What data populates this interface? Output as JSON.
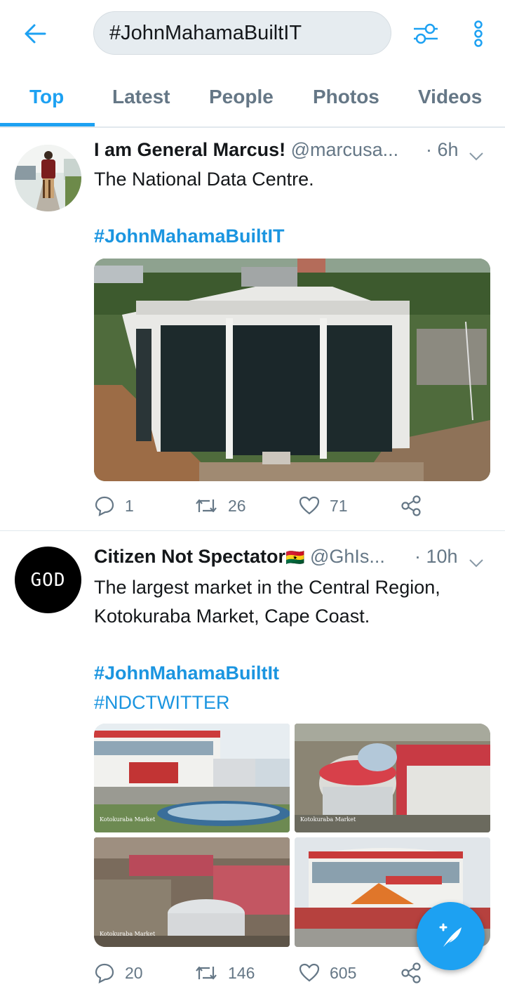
{
  "search": {
    "query": "#JohnMahamaBuiltIT"
  },
  "tabs": [
    {
      "label": "Top"
    },
    {
      "label": "Latest"
    },
    {
      "label": "People"
    },
    {
      "label": "Photos"
    },
    {
      "label": "Videos"
    }
  ],
  "tweets": [
    {
      "name": "I am General Marcus!",
      "handle": "@marcusa...",
      "time": "· 6h",
      "text": "The National Data Centre.",
      "hashtags": [
        "#JohnMahamaBuiltIT"
      ],
      "replies": "1",
      "retweets": "26",
      "likes": "71"
    },
    {
      "name": "Citizen Not Spectator",
      "flag": "🇬🇭",
      "handle": "@GhIs...",
      "time": "· 10h",
      "text_line1": "The largest market in the Central Region,",
      "text_line2": "Kotokuraba Market, Cape Coast.",
      "hashtags": [
        "#JohnMahamaBuiltIt",
        "#NDCTWITTER"
      ],
      "avatar_text": "GOD",
      "image_caption": "Kotokuraba Market",
      "replies": "20",
      "retweets": "146",
      "likes": "605"
    }
  ],
  "colors": {
    "accent": "#1da1f2",
    "muted": "#657786"
  },
  "icons": [
    "back-arrow-icon",
    "filter-icon",
    "more-icon",
    "chevron-down-icon",
    "reply-icon",
    "retweet-icon",
    "like-icon",
    "share-icon",
    "compose-icon"
  ]
}
